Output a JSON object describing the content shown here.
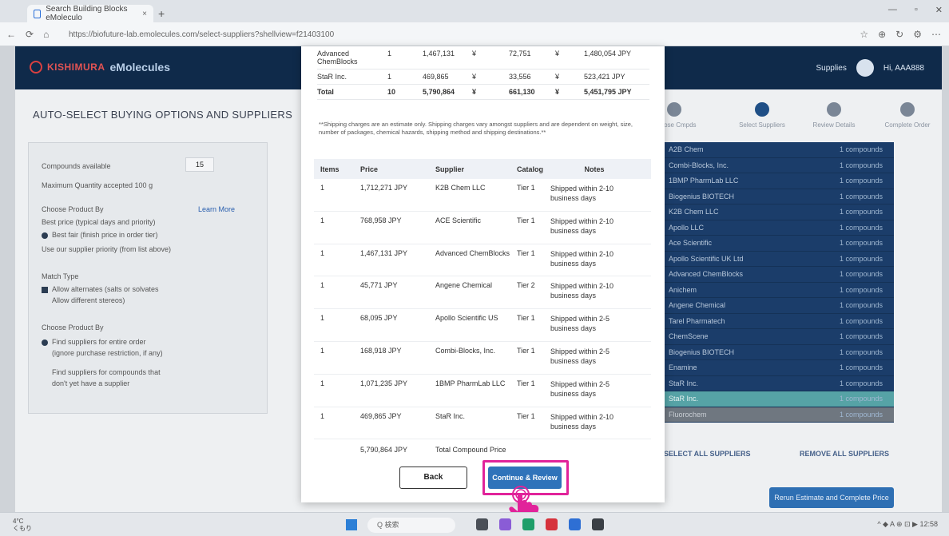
{
  "browser": {
    "tab_title": "Search Building Blocks eMoleculo",
    "tab_close": "×",
    "new_tab": "+",
    "window_controls": [
      "—",
      "▫",
      "✕"
    ],
    "url": "https://biofuture-lab.emolecules.com/select-suppliers?shellview=f21403100",
    "nav_icons": [
      "←",
      "⟳",
      "⌂"
    ],
    "toolbar_icons": [
      "☆",
      "⊕",
      "↻",
      "⚙",
      "⋯"
    ]
  },
  "app": {
    "brand": "KISHIMURA",
    "product": "eMolecules",
    "user_menu_label": "Supplies",
    "greeting": "Hi, AAA888",
    "page_title": "AUTO-SELECT BUYING OPTIONS AND SUPPLIERS",
    "left_panel": {
      "lines": [
        "Compounds available",
        "Maximum Quantity accepted 100 g",
        "Choose Product By",
        "Best price (typical days and priority)",
        "Best fair (finish price in order tier)",
        "Use our supplier priority (from list above)",
        "Match Type",
        "Allow alternates (salts or solvates",
        "Allow different stereos)",
        "Choose Product By",
        "Find suppliers for entire order",
        "(ignore purchase restriction, if any)",
        "Find suppliers for compounds that",
        "don't yet have a supplier"
      ],
      "learn_more": "Learn More",
      "count_value": "15"
    },
    "stepper": [
      "Choose Cmpds",
      "Select Suppliers",
      "Review Details",
      "Complete Order"
    ],
    "suppliers": [
      {
        "name": "A2B Chem",
        "count": "1 compounds"
      },
      {
        "name": "Combi-Blocks, Inc.",
        "count": "1 compounds"
      },
      {
        "name": "1BMP PharmLab LLC",
        "count": "1 compounds"
      },
      {
        "name": "Biogenius BIOTECH",
        "count": "1 compounds"
      },
      {
        "name": "K2B Chem LLC",
        "count": "1 compounds"
      },
      {
        "name": "Apollo LLC",
        "count": "1 compounds"
      },
      {
        "name": "Ace Scientific",
        "count": "1 compounds"
      },
      {
        "name": "Apollo Scientific UK Ltd",
        "count": "1 compounds"
      },
      {
        "name": "Advanced ChemBlocks",
        "count": "1 compounds"
      },
      {
        "name": "Anichem",
        "count": "1 compounds"
      },
      {
        "name": "Angene Chemical",
        "count": "1 compounds"
      },
      {
        "name": "Tarel Pharmatech",
        "count": "1 compounds"
      },
      {
        "name": "ChemScene",
        "count": "1 compounds"
      },
      {
        "name": "Biogenius BIOTECH",
        "count": "1 compounds"
      },
      {
        "name": "Enamine",
        "count": "1 compounds"
      },
      {
        "name": "StaR Inc.",
        "count": "1 compounds"
      },
      {
        "name": "StaR Inc.",
        "count": "1 compounds"
      },
      {
        "name": "Fluorochem",
        "count": "1 compounds"
      }
    ],
    "bulk_left": "SELECT ALL SUPPLIERS",
    "bulk_right": "REMOVE ALL SUPPLIERS",
    "big_button": "Rerun Estimate and Complete Price"
  },
  "modal": {
    "top_rows": [
      {
        "supplier": "Advanced ChemBlocks",
        "items": "1",
        "price": "1,467,131",
        "cur1": "¥",
        "ship": "72,751",
        "cur2": "¥",
        "total": "1,480,054 JPY"
      },
      {
        "supplier": "StaR Inc.",
        "items": "1",
        "price": "469,865",
        "cur1": "¥",
        "ship": "33,556",
        "cur2": "¥",
        "total": "523,421 JPY"
      },
      {
        "supplier": "Total",
        "items": "10",
        "price": "5,790,864",
        "cur1": "¥",
        "ship": "661,130",
        "cur2": "¥",
        "total": "5,451,795 JPY"
      }
    ],
    "note": "**Shipping charges are an estimate only. Shipping charges vary amongst suppliers and are dependent on weight, size, number of packages, chemical hazards, shipping method and shipping destinations.**",
    "headers": [
      "Items",
      "Price",
      "Supplier",
      "Catalog",
      "Notes"
    ],
    "rows": [
      {
        "items": "1",
        "price": "1,712,271 JPY",
        "supplier": "K2B Chem LLC",
        "catalog": "Tier 1",
        "notes": "Shipped within 2-10 business days"
      },
      {
        "items": "1",
        "price": "768,958 JPY",
        "supplier": "ACE Scientific",
        "catalog": "Tier 1",
        "notes": "Shipped within 2-10 business days"
      },
      {
        "items": "1",
        "price": "1,467,131 JPY",
        "supplier": "Advanced ChemBlocks",
        "catalog": "Tier 1",
        "notes": "Shipped within 2-10 business days"
      },
      {
        "items": "1",
        "price": "45,771 JPY",
        "supplier": "Angene Chemical",
        "catalog": "Tier 2",
        "notes": "Shipped within 2-10 business days"
      },
      {
        "items": "1",
        "price": "68,095 JPY",
        "supplier": "Apollo Scientific US",
        "catalog": "Tier 1",
        "notes": "Shipped within 2-5 business days"
      },
      {
        "items": "1",
        "price": "168,918 JPY",
        "supplier": "Combi-Blocks, Inc.",
        "catalog": "Tier 1",
        "notes": "Shipped within 2-5 business days"
      },
      {
        "items": "1",
        "price": "1,071,235 JPY",
        "supplier": "1BMP PharmLab LLC",
        "catalog": "Tier 1",
        "notes": "Shipped within 2-5 business days"
      },
      {
        "items": "1",
        "price": "469,865 JPY",
        "supplier": "StaR Inc.",
        "catalog": "Tier 1",
        "notes": "Shipped within 2-10 business days"
      }
    ],
    "total_price": "5,790,864 JPY",
    "total_label": "Total Compound Price",
    "back_label": "Back",
    "continue_label": "Continue & Review"
  },
  "taskbar": {
    "weather": "4°C\nくもり",
    "search_placeholder": "Q 検索",
    "tray": "^  ◆  A  ⊕  ⊡  ▶  12:58"
  },
  "colors": {
    "accent": "#2f73ba",
    "header": "#0f2a4a",
    "highlight": "#e1239a"
  }
}
